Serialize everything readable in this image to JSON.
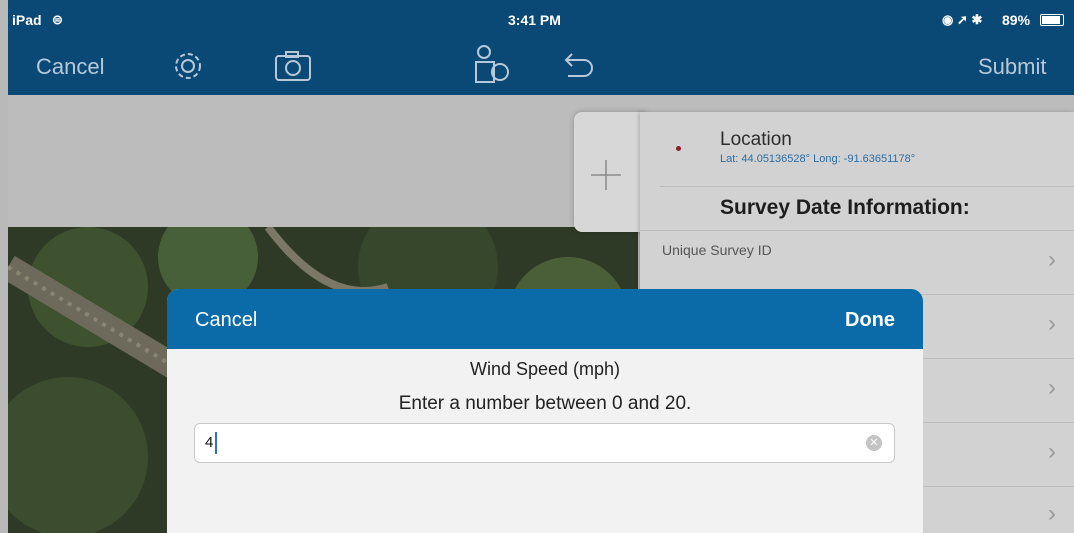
{
  "status_bar": {
    "device": "iPad",
    "time": "3:41 PM",
    "battery": "89%"
  },
  "nav": {
    "cancel_label": "Cancel",
    "submit_label": "Submit"
  },
  "panel": {
    "location_title": "Location",
    "location_coords": "Lat: 44.05136528° Long: -91.63651178°",
    "section_title": "Survey Date Information:",
    "first_field_label": "Unique Survey ID"
  },
  "dialog": {
    "cancel_label": "Cancel",
    "done_label": "Done",
    "question_title": "Wind Speed (mph)",
    "hint": "Enter a number between 0 and 20.",
    "input_value": "4"
  },
  "colors": {
    "nav": "#0a4876",
    "dialog_header": "#0a6ba8",
    "panel": "#d2d2d2"
  }
}
